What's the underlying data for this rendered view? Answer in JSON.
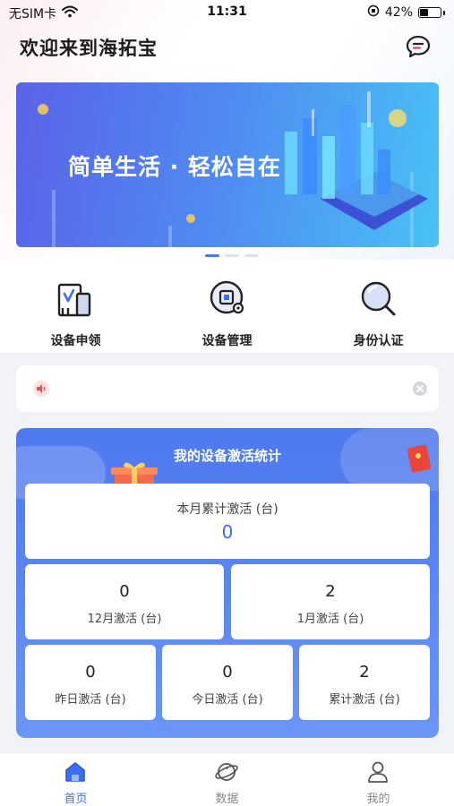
{
  "status_bar": {
    "carrier": "无SIM卡",
    "time": "11:31",
    "battery_percent": "42%",
    "battery_level": 0.42
  },
  "header": {
    "title": "欢迎来到海拓宝",
    "message_icon": "chat-bubble-icon"
  },
  "banner": {
    "text": "简单生活 · 轻松自在",
    "dots_count": 3,
    "active_dot": 0
  },
  "menu": [
    {
      "label": "设备申领",
      "icon": "device-apply-icon"
    },
    {
      "label": "设备管理",
      "icon": "device-manage-icon"
    },
    {
      "label": "身份认证",
      "icon": "search-icon"
    }
  ],
  "notice": {
    "text": "",
    "speaker_icon": "speaker-icon",
    "close_icon": "close-icon"
  },
  "stats": {
    "title": "我的设备激活统计",
    "month_total": {
      "label": "本月累计激活 (台)",
      "value": "0"
    },
    "row2": [
      {
        "value": "0",
        "label": "12月激活 (台)"
      },
      {
        "value": "2",
        "label": "1月激活 (台)"
      }
    ],
    "row3": [
      {
        "value": "0",
        "label": "昨日激活 (台)"
      },
      {
        "value": "0",
        "label": "今日激活 (台)"
      },
      {
        "value": "2",
        "label": "累计激活 (台)"
      }
    ]
  },
  "tabbar": [
    {
      "label": "首页",
      "icon": "home-icon",
      "active": true
    },
    {
      "label": "数据",
      "icon": "planet-icon",
      "active": false
    },
    {
      "label": "我的",
      "icon": "user-icon",
      "active": false
    }
  ],
  "colors": {
    "accent": "#3c6ef0",
    "stats_bg": "#5a86f2"
  }
}
